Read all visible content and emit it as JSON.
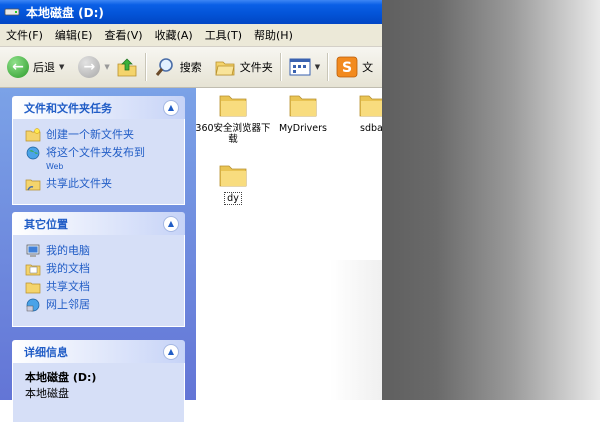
{
  "window": {
    "title": "本地磁盘 (D:)"
  },
  "menu": [
    "文件(F)",
    "编辑(E)",
    "查看(V)",
    "收藏(A)",
    "工具(T)",
    "帮助(H)"
  ],
  "toolbar": {
    "back": "后退",
    "search": "搜索",
    "folders": "文件夹",
    "partial": "文"
  },
  "tasks_panel": {
    "title": "文件和文件夹任务",
    "items": [
      {
        "label": "创建一个新文件夹",
        "icon": "new-folder-icon"
      },
      {
        "label": "将这个文件夹发布到",
        "sub": "Web",
        "icon": "publish-web-icon"
      },
      {
        "label": "共享此文件夹",
        "icon": "share-folder-icon"
      }
    ]
  },
  "places_panel": {
    "title": "其它位置",
    "items": [
      {
        "label": "我的电脑",
        "icon": "my-computer-icon"
      },
      {
        "label": "我的文档",
        "icon": "my-documents-icon"
      },
      {
        "label": "共享文档",
        "icon": "shared-documents-icon"
      },
      {
        "label": "网上邻居",
        "icon": "network-places-icon"
      }
    ]
  },
  "details_panel": {
    "title": "详细信息",
    "name": "本地磁盘 (D:)",
    "type": "本地磁盘"
  },
  "files": [
    {
      "name": "360安全浏览器下载"
    },
    {
      "name": "MyDrivers"
    },
    {
      "name": "sdba"
    },
    {
      "name": "dy"
    }
  ],
  "colors": {
    "title_blue": "#0353d6",
    "pane_blue": "#6375d6",
    "link_blue": "#215dc6",
    "folder_yellow": "#f4d46c"
  }
}
